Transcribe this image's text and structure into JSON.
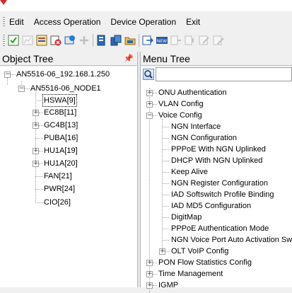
{
  "menubar": {
    "items": [
      "Edit",
      "Access Operation",
      "Device Operation",
      "Exit"
    ]
  },
  "toolbar": {
    "buttons": [
      {
        "icon": "check-icon",
        "enabled": true
      },
      {
        "icon": "chart-icon",
        "enabled": false
      },
      {
        "icon": "list-icon",
        "enabled": true
      },
      {
        "icon": "delete-icon",
        "enabled": true
      },
      {
        "icon": "refresh-icon",
        "enabled": true
      },
      {
        "icon": "add-icon",
        "enabled": false
      },
      {
        "icon": "device-icon",
        "enabled": true
      },
      {
        "icon": "device-group-icon",
        "enabled": true
      },
      {
        "icon": "folder-icon",
        "enabled": true
      },
      {
        "icon": "export-icon",
        "enabled": true
      },
      {
        "icon": "new-icon",
        "enabled": true
      },
      {
        "icon": "connect-icon",
        "enabled": false
      },
      {
        "icon": "disconnect-icon",
        "enabled": false
      },
      {
        "icon": "edit-icon",
        "enabled": false
      },
      {
        "icon": "properties-icon",
        "enabled": false
      }
    ]
  },
  "object_tree": {
    "title": "Object Tree",
    "pin": "📌",
    "root": "AN5516-06_192.168.1.250",
    "node": "AN5516-06_NODE1",
    "cards": [
      {
        "label": "HSWA[9]",
        "expandable": false,
        "selected": true
      },
      {
        "label": "EC8B[11]",
        "expandable": true
      },
      {
        "label": "GC4B[13]",
        "expandable": true
      },
      {
        "label": "PUBA[16]",
        "expandable": false
      },
      {
        "label": "HU1A[19]",
        "expandable": true
      },
      {
        "label": "HU1A[20]",
        "expandable": true
      },
      {
        "label": "FAN[21]",
        "expandable": false
      },
      {
        "label": "PWR[24]",
        "expandable": false
      },
      {
        "label": "CIO[26]",
        "expandable": false
      }
    ]
  },
  "menu_tree": {
    "title": "Menu Tree",
    "search": {
      "placeholder": "",
      "value": ""
    },
    "top": [
      {
        "label": "ONU Authentication",
        "expanded": false
      },
      {
        "label": "VLAN Config",
        "expanded": false
      },
      {
        "label": "Voice Config",
        "expanded": true
      }
    ],
    "voice_children": [
      {
        "label": "NGN Interface",
        "expandable": false
      },
      {
        "label": "NGN Configuration",
        "expandable": false
      },
      {
        "label": "PPPoE With NGN Uplinked",
        "expandable": false
      },
      {
        "label": "DHCP With NGN Uplinked",
        "expandable": false
      },
      {
        "label": "Keep Alive",
        "expandable": false
      },
      {
        "label": "NGN Register Configuration",
        "expandable": false
      },
      {
        "label": "IAD Softswitch Profile Binding",
        "expandable": false
      },
      {
        "label": "IAD MD5 Configuration",
        "expandable": false
      },
      {
        "label": "DigitMap",
        "expandable": false
      },
      {
        "label": "PPPoE Authentication Mode",
        "expandable": false
      },
      {
        "label": "NGN Voice Port Auto Activation Swit",
        "expandable": false
      },
      {
        "label": "OLT VoIP Config",
        "expandable": true
      }
    ],
    "bottom": [
      {
        "label": "PON Flow Statistics Config"
      },
      {
        "label": "Time Management"
      },
      {
        "label": "IGMP"
      }
    ]
  }
}
